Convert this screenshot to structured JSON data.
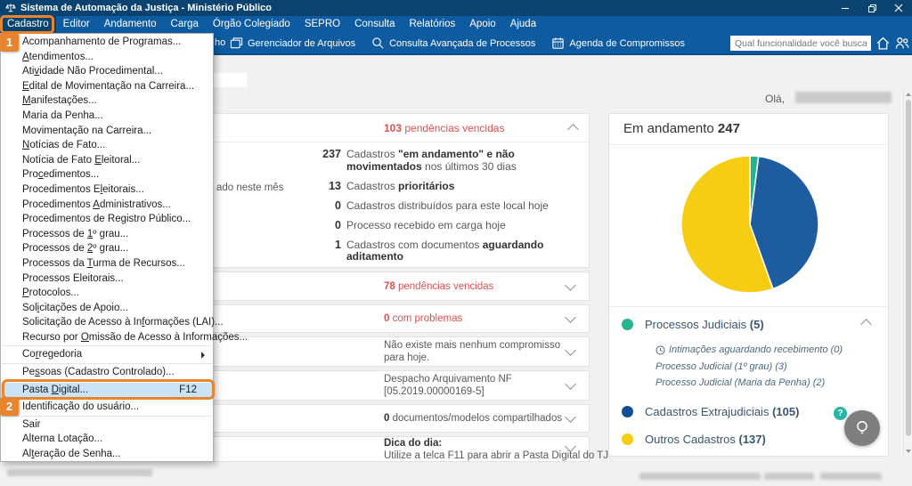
{
  "colors": {
    "titlebar": "#0a436f",
    "menubar": "#0e5ba1",
    "accent_orange": "#e8842c",
    "red": "#db5151",
    "highlight_blue": "#cbe3f6",
    "teal": "#26b48f",
    "blue": "#1d5c9e",
    "yellow": "#f6cd13"
  },
  "window": {
    "title": "Sistema de Automação da Justiça - Ministério Público"
  },
  "menubar": {
    "items": [
      "Cadastro",
      "Editor",
      "Andamento",
      "Carga",
      "Órgão Colegiado",
      "SEPRO",
      "Consulta",
      "Relatórios",
      "Apoio",
      "Ajuda"
    ],
    "active": "Cadastro"
  },
  "toolbar": {
    "hidden_fragment": "ho",
    "buttons": [
      {
        "icon": "file-manager-icon",
        "label": "Gerenciador de Arquivos"
      },
      {
        "icon": "advanced-search-icon",
        "label": "Consulta Avançada de Processos"
      },
      {
        "icon": "calendar-icon",
        "label": "Agenda de Compromissos"
      }
    ],
    "search": {
      "placeholder": "Qual funcionalidade você busca?"
    }
  },
  "callouts": {
    "one": "1",
    "two": "2"
  },
  "menu": {
    "items": [
      {
        "label": "Acompanhamento de Programas..."
      },
      {
        "label": "&Atendimentos..."
      },
      {
        "label": "Ati&vidade Não Procedimental..."
      },
      {
        "label": "&Edital de Movimentação na Carreira..."
      },
      {
        "label": "&Manifestações..."
      },
      {
        "label": "Maria da Penha..."
      },
      {
        "label": "Movimentação na Carreira..."
      },
      {
        "label": "&Notícias de Fato..."
      },
      {
        "label": "Notícia de Fato &Eleitoral..."
      },
      {
        "label": "Pro&cedimentos..."
      },
      {
        "label": "Procedimentos E&leitorais..."
      },
      {
        "label": "Procedimentos &Administrativos..."
      },
      {
        "label": "Procedimentos de Re&gistro Público..."
      },
      {
        "label": "Processos de &1º grau..."
      },
      {
        "label": "Processos de &2º grau..."
      },
      {
        "label": "Processos da &Turma de Recursos..."
      },
      {
        "label": "Processos Eleitorais..."
      },
      {
        "label": "&Protocolos..."
      },
      {
        "label": "Sol&icitações de Apoio..."
      },
      {
        "label": "Solicitação de Acesso à In&formações (LAI)..."
      },
      {
        "label": "Recurso por &Omissão de Acesso à Informações...",
        "separator_after": true
      },
      {
        "label": "Co&rregedoria",
        "submenu": true,
        "separator_after": true
      },
      {
        "label": "Pe&ssoas (Cadastro Controlado)...",
        "separator_after": true
      },
      {
        "label": "Pasta &Digital...",
        "shortcut": "F12",
        "highlighted": true,
        "separator_after": true
      },
      {
        "label": "Identificação do usuário...",
        "separator_after": true
      },
      {
        "label": "Sair"
      },
      {
        "label": "Alterna Lotação..."
      },
      {
        "label": "Al&teração de Senha..."
      }
    ]
  },
  "greeting": "Olá,",
  "left_fragment": "ado neste mês",
  "pendencias": {
    "header_segments": [
      [
        "103",
        3
      ],
      [
        " pendências vencidas",
        2
      ]
    ],
    "items": [
      {
        "count": "237",
        "segments": [
          [
            "Cadastros ",
            0
          ],
          [
            "\"em andamento\" e não movimentados",
            1
          ],
          [
            " nos últimos 30 dias",
            0
          ]
        ]
      },
      {
        "count": "13",
        "segments": [
          [
            "Cadastros ",
            0
          ],
          [
            "prioritários",
            1
          ]
        ]
      },
      {
        "count": "0",
        "segments": [
          [
            "Cadastros distribuídos para este local hoje",
            0
          ]
        ]
      },
      {
        "count": "0",
        "segments": [
          [
            "Processo recebido em carga hoje",
            0
          ]
        ]
      },
      {
        "count": "1",
        "segments": [
          [
            "Cadastros com documentos ",
            0
          ],
          [
            "aguardando aditamento",
            1
          ]
        ]
      }
    ]
  },
  "rows": [
    {
      "segments": [
        [
          "78",
          3
        ],
        [
          " pendências vencidas",
          2
        ]
      ]
    },
    {
      "segments": [
        [
          "0",
          3
        ],
        [
          " com problemas",
          2
        ]
      ]
    },
    {
      "segments": [
        [
          "Não existe mais nenhum compromisso para hoje.",
          0
        ]
      ]
    },
    {
      "segments": [
        [
          "Despacho Arquivamento NF [05.2019.00000169-5]",
          0
        ]
      ]
    },
    {
      "segments": [
        [
          "0",
          1
        ],
        [
          " documentos/modelos compartilhados",
          0
        ]
      ]
    },
    {
      "segments": [
        [
          "Dica do dia:",
          1
        ],
        [
          "\nUtilize a telca F11 para abrir a Pasta Digital do TJ",
          0
        ]
      ]
    }
  ],
  "andamento": {
    "title": "Em andamento",
    "total": "247",
    "help_badge": "?",
    "legend": [
      {
        "label": "Processos Judiciais",
        "count": "5",
        "color": "#26b48f",
        "state": "expanded",
        "children": [
          {
            "icon": "clock",
            "text": "Intimações aguardando recebimento (0)"
          },
          {
            "text": "Processo Judicial (1º grau) (3)"
          },
          {
            "text": "Processo Judicial (Maria da Penha) (2)"
          }
        ]
      },
      {
        "label": "Cadastros Extrajudiciais",
        "count": "105",
        "color": "#0f4f96",
        "state": "collapsed"
      },
      {
        "label": "Outros Cadastros",
        "count": "137",
        "color": "#f6cd13"
      }
    ]
  },
  "chart_data": {
    "type": "pie",
    "title": "Em andamento 247",
    "total": 247,
    "labels": [
      "Processos Judiciais",
      "Cadastros Extrajudiciais",
      "Outros Cadastros"
    ],
    "values": [
      5,
      105,
      137
    ],
    "colors": [
      "#26b48f",
      "#1d5c9e",
      "#f6cd13"
    ],
    "start_angle_deg": 0,
    "direction": "clockwise",
    "legend_position": "bottom"
  }
}
